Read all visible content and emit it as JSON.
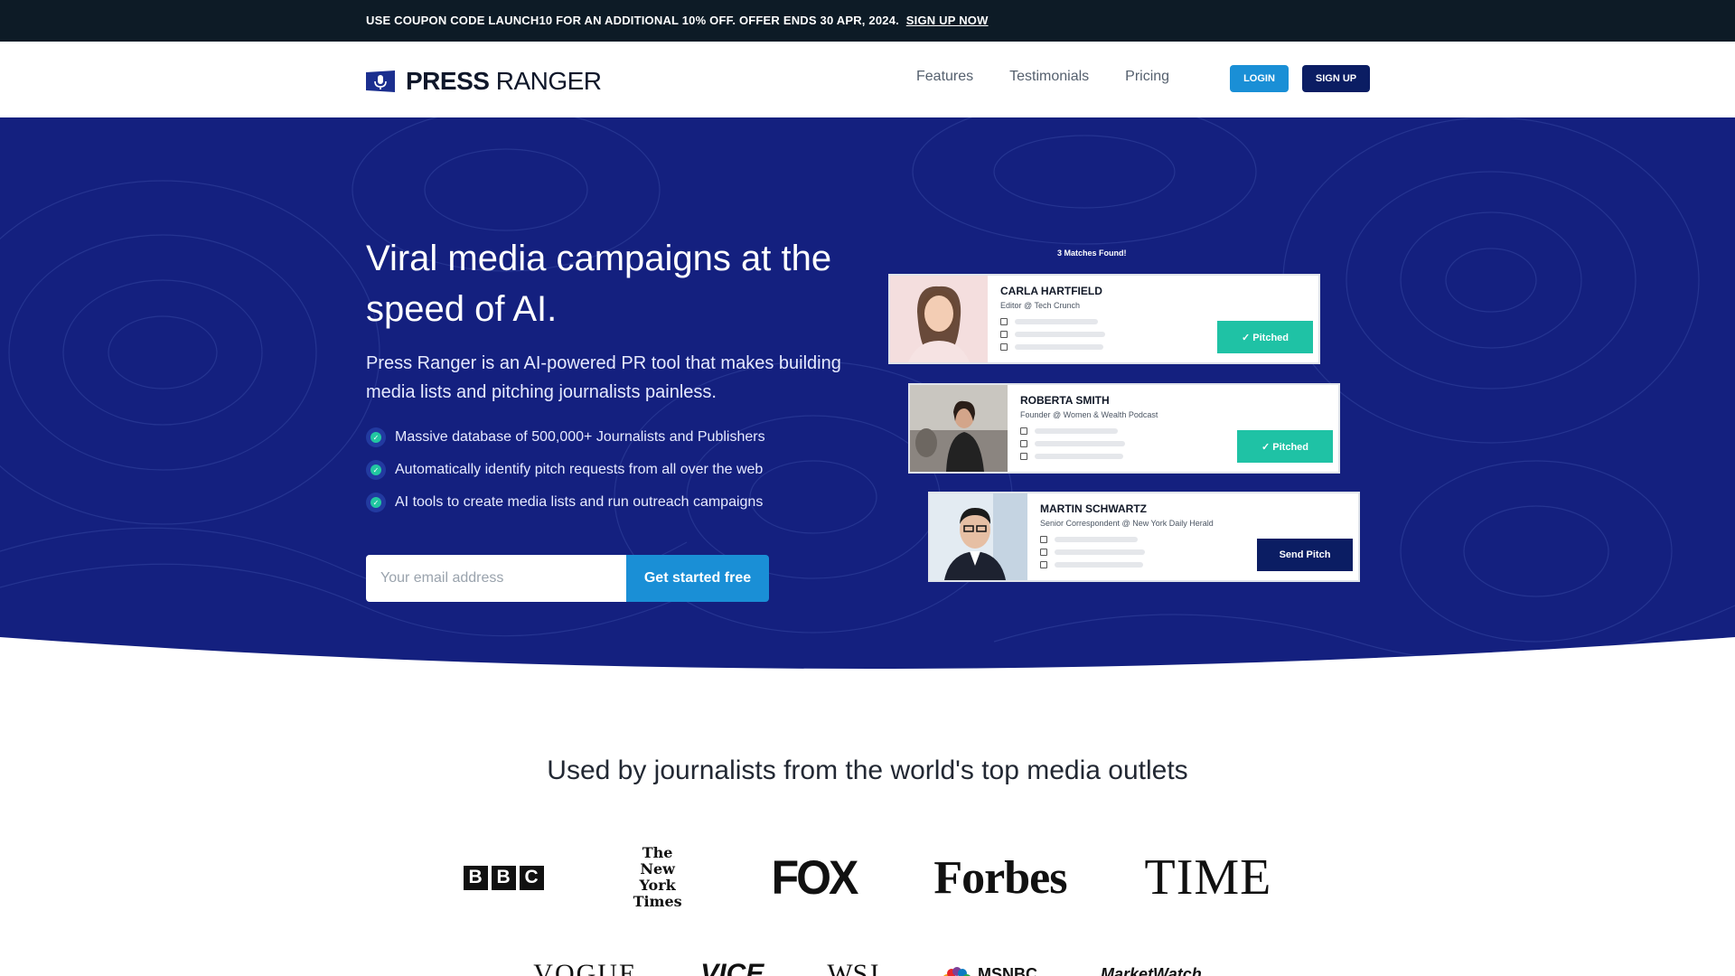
{
  "promo": {
    "text": "USE COUPON CODE LAUNCH10 FOR AN ADDITIONAL 10% OFF. OFFER ENDS 30 APR, 2024.",
    "link": "SIGN UP NOW"
  },
  "header": {
    "brand_bold": "PRESS",
    "brand_regular": " RANGER",
    "nav": [
      "Features",
      "Testimonials",
      "Pricing"
    ],
    "login": "LOGIN",
    "signup": "SIGN UP"
  },
  "hero": {
    "title": "Viral media campaigns at the speed of AI.",
    "subtitle": "Press Ranger is an AI-powered PR tool that makes building media lists and pitching journalists painless.",
    "features": [
      "Massive database of 500,000+ Journalists and Publishers",
      "Automatically identify pitch requests from all over the web",
      "AI tools to create media lists and run outreach campaigns"
    ],
    "email_placeholder": "Your email address",
    "cta": "Get started free"
  },
  "matches": {
    "label": "3 Matches Found!",
    "cards": [
      {
        "name": "CARLA HARTFIELD",
        "role": "Editor @ Tech Crunch",
        "button": "Pitched",
        "status": "pitched"
      },
      {
        "name": "ROBERTA SMITH",
        "role": "Founder @ Women & Wealth Podcast",
        "button": "Pitched",
        "status": "pitched"
      },
      {
        "name": "MARTIN SCHWARTZ",
        "role": "Senior Correspondent @ New York Daily Herald",
        "button": "Send Pitch",
        "status": "send"
      }
    ]
  },
  "outlets": {
    "title": "Used by journalists from the world's top media outlets",
    "row1": [
      "BBC",
      "The New York Times",
      "FOX",
      "Forbes",
      "TIME"
    ],
    "row2": [
      "VOGUE",
      "VICE",
      "WSJ",
      "MSNBC",
      "MarketWatch"
    ]
  },
  "colors": {
    "hero_bg": "#14207f",
    "accent_blue": "#1a8fd6",
    "navy": "#0b1d63",
    "teal": "#1fc2a5",
    "promo_bg": "#0d1b26"
  }
}
